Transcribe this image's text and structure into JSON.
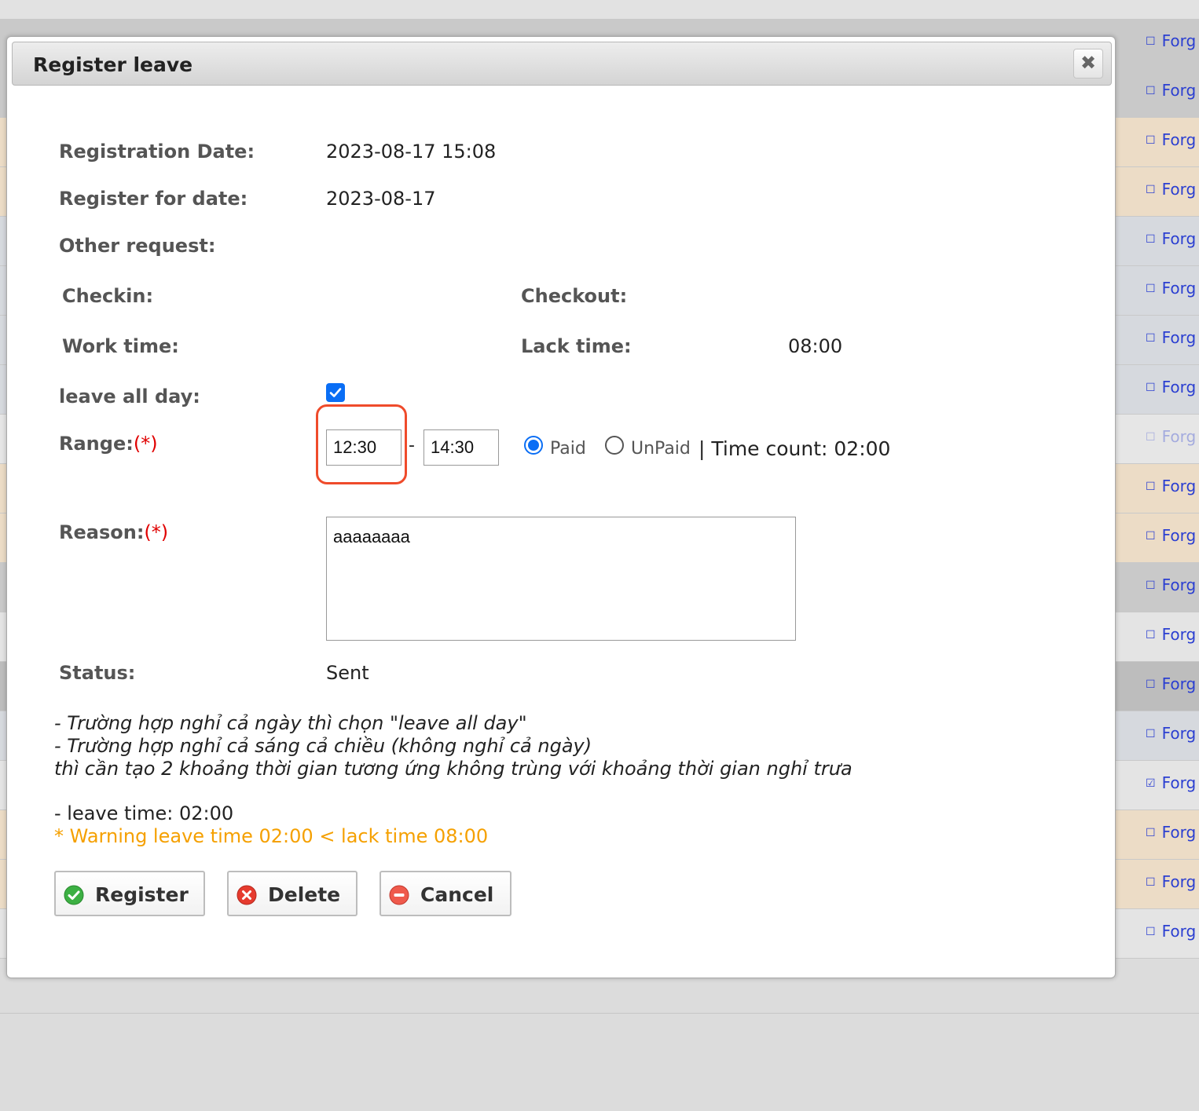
{
  "background": {
    "row_link_label": "Forg",
    "row_link_checked_index": 15
  },
  "dialog": {
    "title": "Register leave",
    "close_icon": "close-icon",
    "fields": {
      "registration_date_label": "Registration Date:",
      "registration_date_value": "2023-08-17 15:08",
      "register_for_date_label": "Register for date:",
      "register_for_date_value": "2023-08-17",
      "other_request_label": "Other request:",
      "checkin_label": "Checkin:",
      "checkout_label": "Checkout:",
      "work_time_label": "Work time:",
      "lack_time_label": "Lack time:",
      "lack_time_value": "08:00",
      "leave_all_day_label": "leave all day:",
      "leave_all_day_checked": true,
      "range_label": "Range:",
      "required_mark": "(*)",
      "range_from": "12:30",
      "range_separator": "-",
      "range_to": "14:30",
      "paid_label": "Paid",
      "unpaid_label": "UnPaid",
      "selected_pay_type": "Paid",
      "time_count_text": "| Time count: 02:00",
      "reason_label": "Reason:",
      "reason_value": "aaaaaaaa",
      "status_label": "Status:",
      "status_value": "Sent"
    },
    "notes": [
      "- Trường hợp nghỉ cả ngày thì chọn \"leave all day\"",
      "- Trường hợp nghỉ cả sáng cả chiều (không nghỉ cả ngày)",
      "thì cần tạo 2 khoảng thời gian tương ứng không trùng với khoảng thời gian nghỉ trưa"
    ],
    "leave_time_text": "- leave time: 02:00",
    "warning_text": "* Warning leave time 02:00 < lack time 08:00",
    "buttons": {
      "register_label": "Register",
      "delete_label": "Delete",
      "cancel_label": "Cancel"
    }
  },
  "colors": {
    "accent": "#0a6ef5",
    "required": "#e00000",
    "warning": "#f5a000",
    "highlight": "#ef4b2b",
    "link": "#2b3fd1"
  }
}
